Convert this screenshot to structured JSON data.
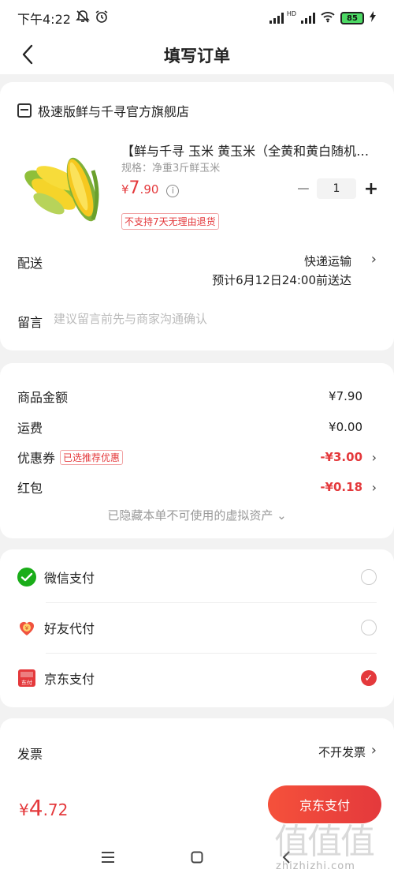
{
  "status_bar": {
    "time": "下午4:22",
    "battery": "85",
    "net_label": "HD"
  },
  "nav": {
    "title": "填写订单"
  },
  "shop": {
    "name": "极速版鲜与千寻官方旗舰店"
  },
  "product": {
    "title": "【鲜与千寻 玉米 黄玉米（全黄和黄白随机…",
    "spec": "规格：净重3斤鲜玉米",
    "price_symbol": "¥",
    "price_int": "7",
    "price_dec": ".90",
    "quantity": "1",
    "return_policy": "不支持7天无理由退货"
  },
  "delivery": {
    "label": "配送",
    "method": "快递运输",
    "eta": "预计6月12日24:00前送达"
  },
  "note": {
    "label": "留言",
    "placeholder": "建议留言前先与商家沟通确认"
  },
  "summary": {
    "goods_label": "商品金额",
    "goods_value": "¥7.90",
    "shipping_label": "运费",
    "shipping_value": "¥0.00",
    "coupon_label": "优惠券",
    "coupon_badge": "已选推荐优惠",
    "coupon_value": "-¥3.00",
    "redpacket_label": "红包",
    "redpacket_value": "-¥0.18",
    "hidden_assets": "已隐藏本单不可使用的虚拟资产 ⌄"
  },
  "payment_methods": [
    {
      "label": "微信支付",
      "icon": "wechat-pay-icon",
      "selected": false
    },
    {
      "label": "好友代付",
      "icon": "friend-pay-icon",
      "selected": false
    },
    {
      "label": "京东支付",
      "icon": "jd-pay-icon",
      "icon_text": "东付",
      "selected": true
    }
  ],
  "invoice": {
    "label": "发票",
    "value": "不开发票"
  },
  "bottom": {
    "total_symbol": "¥",
    "total_int": "4",
    "total_dec": ".72",
    "pay_button": "京东支付"
  },
  "watermark": {
    "glyphs": "值值值",
    "text": "zhizhizhi.com"
  },
  "colors": {
    "accent": "#e4393c",
    "wechat": "#1aad19",
    "friend_pay": "#f0533f"
  }
}
